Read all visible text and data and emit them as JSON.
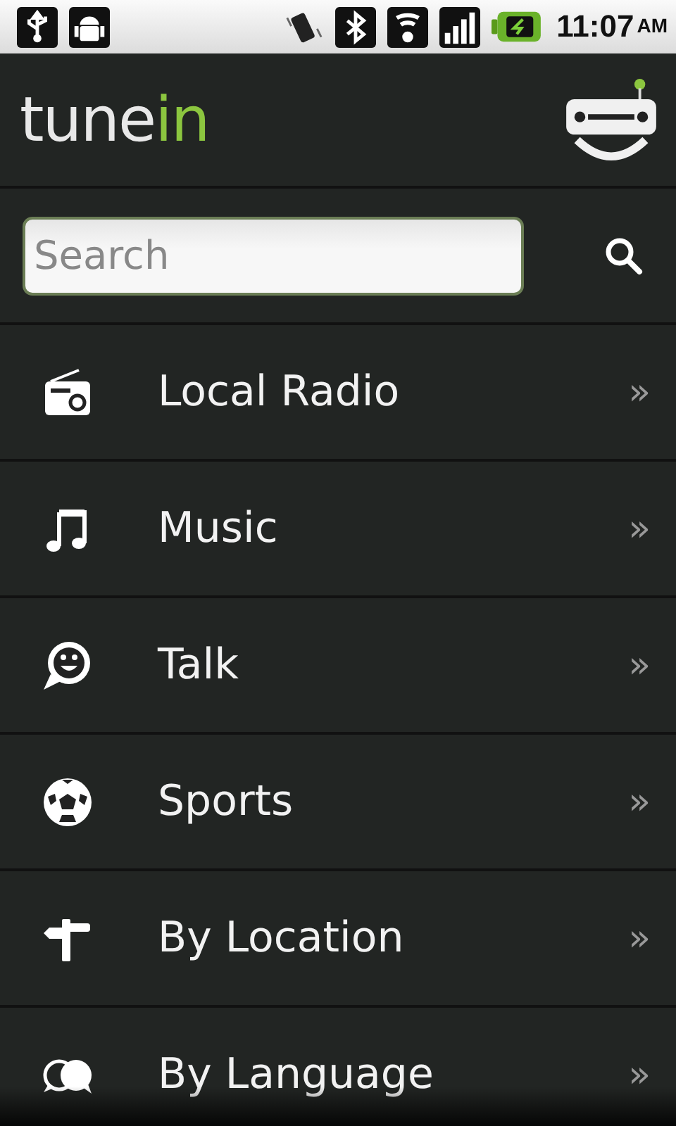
{
  "status_bar": {
    "time": "11:07",
    "ampm": "AM"
  },
  "header": {
    "logo": {
      "text": "tune",
      "accent": "in"
    }
  },
  "search": {
    "placeholder": "Search"
  },
  "menu": [
    {
      "label": "Local Radio",
      "chevron": "»"
    },
    {
      "label": "Music",
      "chevron": "»"
    },
    {
      "label": "Talk",
      "chevron": "»"
    },
    {
      "label": "Sports",
      "chevron": "»"
    },
    {
      "label": "By Location",
      "chevron": "»"
    },
    {
      "label": "By Language",
      "chevron": "»"
    }
  ]
}
